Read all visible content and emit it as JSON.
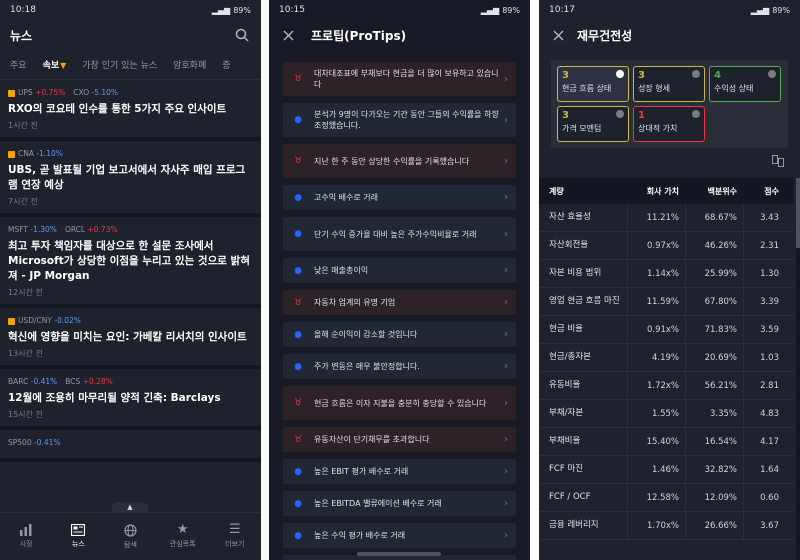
{
  "p1": {
    "time": "10:18",
    "battery": "89%",
    "title": "뉴스",
    "tabs": [
      "주요",
      "속보",
      "가장 인기 있는 뉴스",
      "암호화폐",
      "증"
    ],
    "news": [
      {
        "tickers": [
          {
            "sym": "UPS",
            "chg": "+0.75%",
            "dir": "up",
            "dot": true
          },
          {
            "sym": "CXO",
            "chg": "-5.10%",
            "dir": "down"
          }
        ],
        "headline": "RXO의 코요테 인수를 통한 5가지 주요 인사이트",
        "time": "1시간 전"
      },
      {
        "tickers": [
          {
            "sym": "CNA",
            "chg": "-1.10%",
            "dir": "down",
            "dot": true
          }
        ],
        "headline": "UBS, 곧 발표될 기업 보고서에서 자사주 매입 프로그램 연장 예상",
        "time": "7시간 전"
      },
      {
        "tickers": [
          {
            "sym": "MSFT",
            "chg": "-1.30%",
            "dir": "down"
          },
          {
            "sym": "ORCL",
            "chg": "+0.73%",
            "dir": "up"
          }
        ],
        "headline": "최고 투자 책임자를 대상으로 한 설문 조사에서 Microsoft가 상당한 이점을 누리고 있는 것으로 밝혀져 - JP Morgan",
        "time": "12시간 전"
      },
      {
        "tickers": [
          {
            "sym": "USD/CNY",
            "chg": "-0.02%",
            "dir": "down",
            "dot": true
          }
        ],
        "headline": "혁신에 영향을 미치는 요인: 가베칼 리서치의 인사이트",
        "time": "13시간 전"
      },
      {
        "tickers": [
          {
            "sym": "BARC",
            "chg": "-0.41%",
            "dir": "down"
          },
          {
            "sym": "BCS",
            "chg": "+0.28%",
            "dir": "up"
          }
        ],
        "headline": "12월에 조용히 마무리될 양적 긴축: Barclays",
        "time": "15시간 전"
      },
      {
        "tickers": [
          {
            "sym": "SP500",
            "chg": "-0.41%",
            "dir": "down"
          }
        ],
        "headline": "",
        "time": ""
      }
    ],
    "nav": [
      "시장",
      "뉴스",
      "탐색",
      "관심목록",
      "더보기"
    ]
  },
  "p2": {
    "time": "10:15",
    "battery": "89%",
    "title": "프로팁(ProTips)",
    "tips": [
      {
        "kind": "bull",
        "text": "대차대조표에 부채보다 현금을 더 많이 보유하고 있습니다"
      },
      {
        "kind": "bear",
        "text": "분석가 9명이 다가오는 기간 동안 그들의 수익률을 하향 조정했습니다."
      },
      {
        "kind": "bull",
        "text": "지난 한 주 동안 상당한 수익률을 기록했습니다"
      },
      {
        "kind": "bear",
        "text": "고수익 배수로 거래"
      },
      {
        "kind": "bear",
        "text": "단기 수익 증가율 대비 높은 주가수익비율로 거래"
      },
      {
        "kind": "bear",
        "text": "낮은 매출총이익"
      },
      {
        "kind": "bull",
        "text": "자동차 업계의 유명 기업"
      },
      {
        "kind": "bear",
        "text": "올해 순이익이 감소할 것입니다"
      },
      {
        "kind": "bear",
        "text": "주가 변동은 매우 불안정합니다."
      },
      {
        "kind": "bull",
        "text": "현금 흐름은 이자 지불을 충분히 충당할 수 있습니다"
      },
      {
        "kind": "bull",
        "text": "유동자산이 단기채무를 초과합니다"
      },
      {
        "kind": "bear",
        "text": "높은 EBIT 평가 배수로 거래"
      },
      {
        "kind": "bear",
        "text": "높은 EBITDA 밸류에이션 배수로 거래"
      },
      {
        "kind": "bear",
        "text": "높은 수익 평가 배수로 거래"
      },
      {
        "kind": "bear",
        "text": "높은 가격으로 거래 / 여러 번 예약"
      }
    ]
  },
  "p3": {
    "time": "10:17",
    "battery": "89%",
    "title": "재무건전성",
    "cards": [
      {
        "num": "3",
        "label": "현금 흐름 상태",
        "color": "#c9b843",
        "selected": true
      },
      {
        "num": "3",
        "label": "성장 형세",
        "color": "#c9b843",
        "selected": false
      },
      {
        "num": "4",
        "label": "수익성 상태",
        "color": "#4caf50",
        "selected": false
      },
      {
        "num": "3",
        "label": "가격 모멘텀",
        "color": "#c9b843",
        "selected": false
      },
      {
        "num": "1",
        "label": "상대적 가치",
        "color": "#f23645",
        "selected": false
      }
    ],
    "headers": [
      "계량",
      "회사 가치",
      "백분위수",
      "점수"
    ],
    "rows": [
      [
        "자산 효율성",
        "11.21%",
        "68.67%",
        "3.43"
      ],
      [
        "자산회전율",
        "0.97x%",
        "46.26%",
        "2.31"
      ],
      [
        "자본 비용 범위",
        "1.14x%",
        "25.99%",
        "1.30"
      ],
      [
        "영업 현금 흐름 마진",
        "11.59%",
        "67.80%",
        "3.39"
      ],
      [
        "현금 비율",
        "0.91x%",
        "71.83%",
        "3.59"
      ],
      [
        "현금/총자본",
        "4.19%",
        "20.69%",
        "1.03"
      ],
      [
        "유동비율",
        "1.72x%",
        "56.21%",
        "2.81"
      ],
      [
        "부채/자본",
        "1.55%",
        "3.35%",
        "4.83"
      ],
      [
        "부채비율",
        "15.40%",
        "16.54%",
        "4.17"
      ],
      [
        "FCF 마진",
        "1.46%",
        "32.82%",
        "1.64"
      ],
      [
        "FCF / OCF",
        "12.58%",
        "12.09%",
        "0.60"
      ],
      [
        "금융 레버리지",
        "1.70x%",
        "26.66%",
        "3.67"
      ]
    ]
  }
}
